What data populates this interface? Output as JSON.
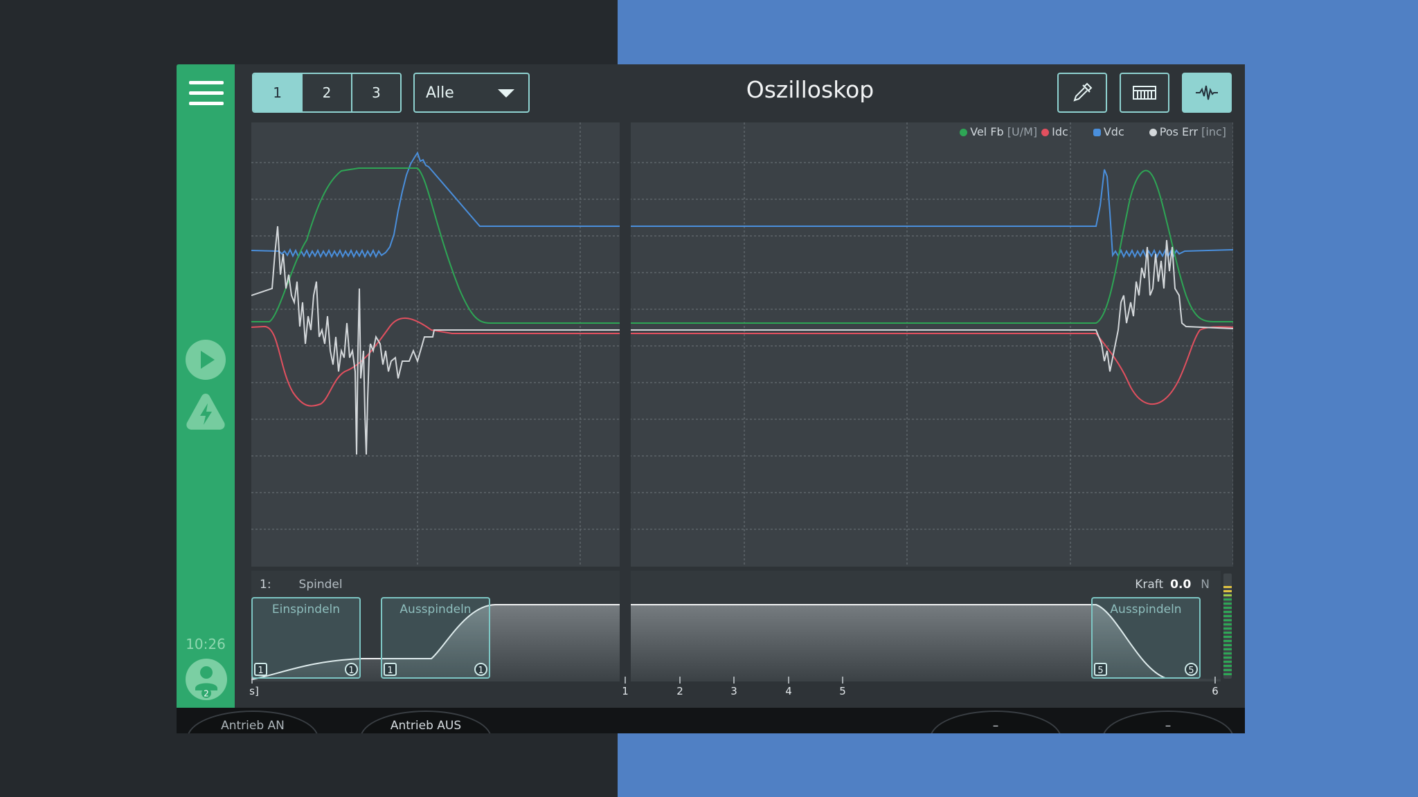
{
  "title": "Oszilloskop",
  "tabs": [
    {
      "label": "1",
      "active": true
    },
    {
      "label": "2",
      "active": false
    },
    {
      "label": "3",
      "active": false
    }
  ],
  "filter": {
    "selected": "Alle"
  },
  "toolbar": {
    "icons": [
      "pipette-icon",
      "ruler-icon",
      "waveform-icon"
    ],
    "active": "waveform-icon"
  },
  "sidebar": {
    "menu_icon": "hamburger-icon",
    "play_icon": "play-icon",
    "power_icon": "power-warning-icon",
    "clock": "10:26",
    "user_badge": "2"
  },
  "legend": [
    {
      "name": "Vel Fb",
      "unit": "[U/M]",
      "color": "#2ea655"
    },
    {
      "name": "Idc",
      "unit": "",
      "color": "#e2505f"
    },
    {
      "name": "Vdc",
      "unit": "",
      "color": "#4a8fdc"
    },
    {
      "name": "Pos Err",
      "unit": "[inc]",
      "color": "#d4d8db"
    }
  ],
  "timeline": {
    "index": "1:",
    "section": "Spindel",
    "force_label": "Kraft",
    "force_value": "0.0",
    "force_unit": "N",
    "segments": [
      {
        "label": "Einspindeln",
        "left_badge": "1",
        "right_badge": "1"
      },
      {
        "label": "Ausspindeln",
        "left_badge": "1",
        "right_badge": "1"
      },
      {
        "label": "Ausspindeln",
        "left_badge": "5",
        "right_badge": "5"
      }
    ],
    "ticks": [
      "s]",
      "1",
      "2",
      "3",
      "4",
      "5",
      "6"
    ]
  },
  "bottom_buttons": [
    {
      "label": "Antrieb AN"
    },
    {
      "label": "Antrieb AUS"
    },
    {
      "label": "–"
    },
    {
      "label": "–"
    }
  ]
}
